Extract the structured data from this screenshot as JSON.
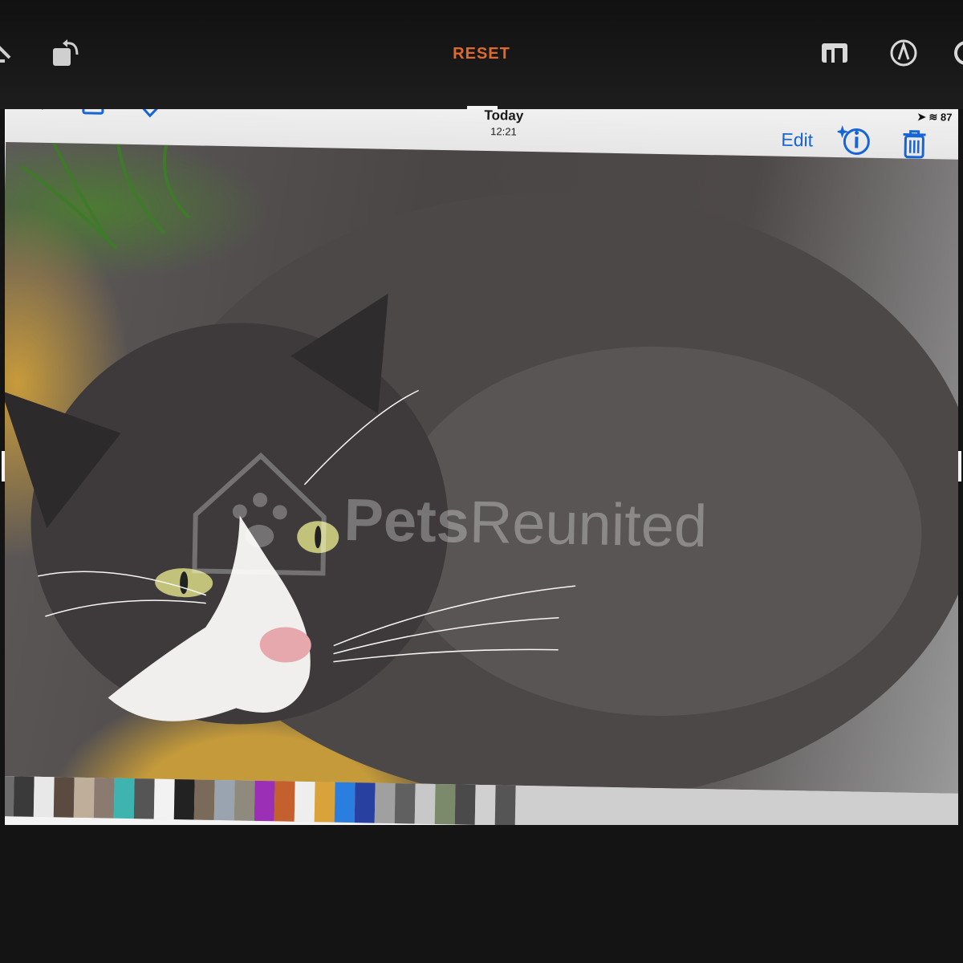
{
  "toolbar": {
    "reset_label": "RESET",
    "icons": [
      "crop-tilt-icon",
      "rotate-icon",
      "aspect-ratio-icon",
      "markup-icon",
      "more-icon"
    ]
  },
  "photo_screenshot": {
    "nav": {
      "title": "Today",
      "time": "12:21",
      "edit_label": "Edit",
      "icons": [
        "back-chevron-icon",
        "share-icon",
        "favorite-heart-icon",
        "info-sparkle-icon",
        "trash-icon"
      ]
    },
    "status": {
      "battery": "87"
    },
    "watermark": {
      "brand_bold": "Pets",
      "brand_light": "Reunited"
    }
  },
  "colors": {
    "accent_orange": "#e06a2b",
    "ios_blue": "#1565d8",
    "background": "#141414"
  }
}
